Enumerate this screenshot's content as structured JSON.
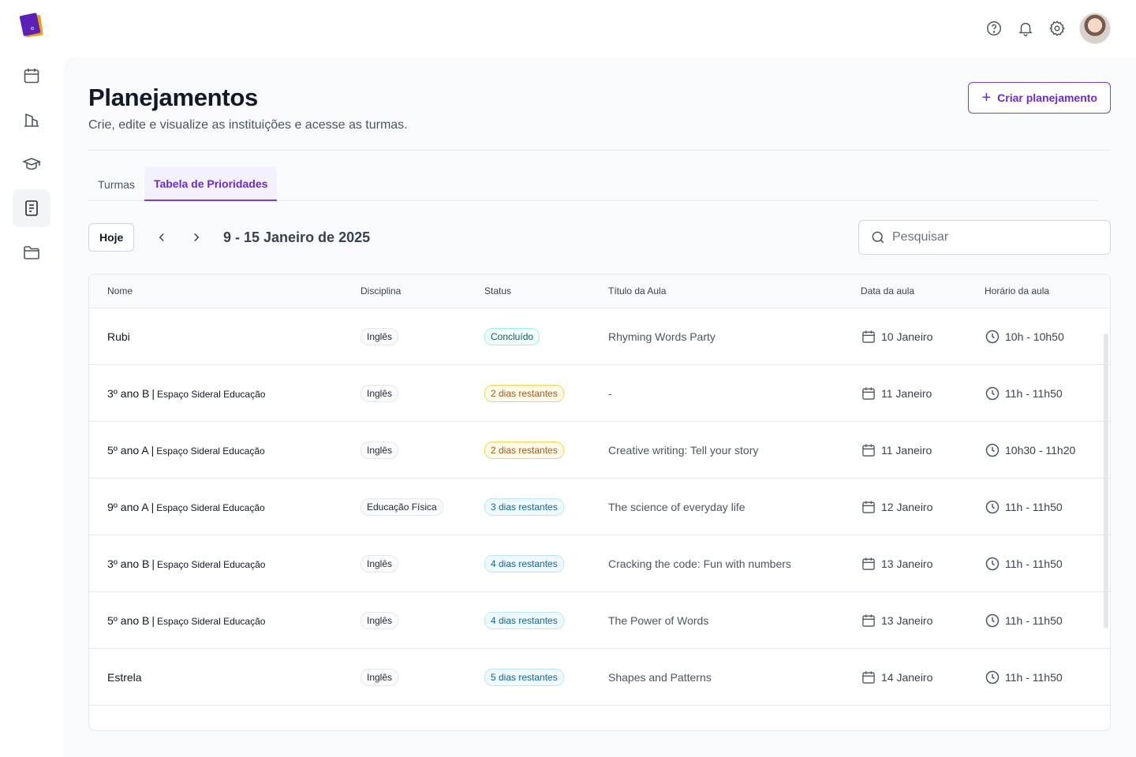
{
  "app": {
    "logo": "book-logo"
  },
  "sidebar": {
    "items": [
      {
        "icon": "calendar-icon",
        "active": false
      },
      {
        "icon": "building-icon",
        "active": false
      },
      {
        "icon": "graduation-cap-icon",
        "active": false
      },
      {
        "icon": "document-icon",
        "active": true
      },
      {
        "icon": "folder-icon",
        "active": false
      }
    ]
  },
  "topbar": {
    "icons": [
      "help-icon",
      "bell-icon",
      "gear-icon"
    ],
    "avatar": "user-avatar"
  },
  "header": {
    "title": "Planejamentos",
    "subtitle": "Crie, edite e visualize as instituições e acesse as turmas.",
    "create_button": "Criar planejamento"
  },
  "tabs": [
    {
      "label": "Turmas",
      "active": false
    },
    {
      "label": "Tabela de Prioridades",
      "active": true
    }
  ],
  "toolbar": {
    "today_label": "Hoje",
    "date_range": "9 - 15 Janeiro de 2025",
    "search_placeholder": "Pesquisar"
  },
  "table": {
    "columns": [
      "Nome",
      "Disciplina",
      "Status",
      "Título da Aula",
      "Data da aula",
      "Horário da aula"
    ],
    "rows": [
      {
        "name": "Rubi",
        "institution": "",
        "subject": "Inglês",
        "status": "Concluído",
        "status_kind": "done",
        "title": "Rhyming Words Party",
        "date": "10 Janeiro",
        "time": "10h - 10h50"
      },
      {
        "name": "3º ano B",
        "institution": "Espaço Sideral Educação",
        "subject": "Inglês",
        "status": "2 dias restantes",
        "status_kind": "warn",
        "title": "-",
        "date": "11 Janeiro",
        "time": "11h - 11h50"
      },
      {
        "name": "5º ano A",
        "institution": "Espaço Sideral Educação",
        "subject": "Inglês",
        "status": "2 dias restantes",
        "status_kind": "warn",
        "title": "Creative writing: Tell your story",
        "date": "11 Janeiro",
        "time": "10h30 - 11h20"
      },
      {
        "name": "9º ano A",
        "institution": "Espaço Sideral Educação",
        "subject": "Educação Física",
        "status": "3 dias restantes",
        "status_kind": "info",
        "title": "The science of everyday life",
        "date": "12 Janeiro",
        "time": "11h - 11h50"
      },
      {
        "name": "3º ano B",
        "institution": "Espaço Sideral Educação",
        "subject": "Inglês",
        "status": "4 dias restantes",
        "status_kind": "info",
        "title": "Cracking the code: Fun with numbers",
        "date": "13 Janeiro",
        "time": "11h - 11h50"
      },
      {
        "name": "5º ano B",
        "institution": "Espaço Sideral Educação",
        "subject": "Inglês",
        "status": "4 dias restantes",
        "status_kind": "info",
        "title": "The Power of Words",
        "date": "13 Janeiro",
        "time": "11h - 11h50"
      },
      {
        "name": "Estrela",
        "institution": "",
        "subject": "Inglês",
        "status": "5 dias restantes",
        "status_kind": "info",
        "title": "Shapes and Patterns",
        "date": "14 Janeiro",
        "time": "11h - 11h50"
      }
    ]
  },
  "colors": {
    "accent": "#6d28d9",
    "background": "#f9fafb"
  }
}
